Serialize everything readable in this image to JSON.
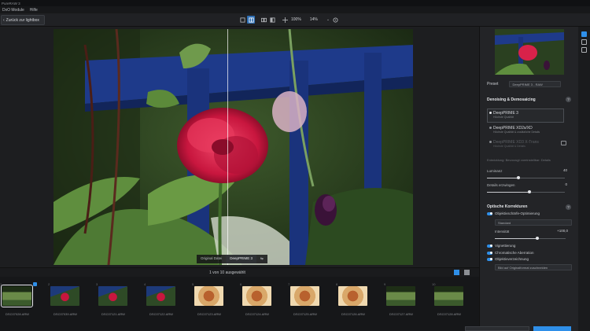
{
  "window": {
    "title": "PureRAW 3"
  },
  "menu": [
    "DxO Module",
    "Hilfe"
  ],
  "toolbar": {
    "back_label": "Zurück zur lightbox",
    "zoom_fit": "100%",
    "zoom_value": "14%"
  },
  "compare": {
    "before": "Original Datei",
    "after": "DeepPRIME 3"
  },
  "status": {
    "selection": "1 von 10 ausgewählt"
  },
  "filmstrip": [
    {
      "num": "1",
      "name": "DSC07028.ARW",
      "type": "garden",
      "selected": true
    },
    {
      "num": "2",
      "name": "DSC07039.ARW",
      "type": "flower",
      "selected": false
    },
    {
      "num": "3",
      "name": "DSC07121.ARW",
      "type": "flower",
      "selected": false
    },
    {
      "num": "4",
      "name": "DSC07122.ARW",
      "type": "flower",
      "selected": false
    },
    {
      "num": "5",
      "name": "DSC07123.ARW",
      "type": "food",
      "selected": false
    },
    {
      "num": "6",
      "name": "DSC07124.ARW",
      "type": "food",
      "selected": false
    },
    {
      "num": "7",
      "name": "DSC07125.ARW",
      "type": "food",
      "selected": false
    },
    {
      "num": "8",
      "name": "DSC07126.ARW",
      "type": "food",
      "selected": false
    },
    {
      "num": "9",
      "name": "DSC07127.ARW",
      "type": "garden",
      "selected": false
    },
    {
      "num": "10",
      "name": "DSC07128.ARW",
      "type": "garden",
      "selected": false
    }
  ],
  "panel": {
    "preset_label": "Preset",
    "preset_value": "DeepPRIME 3 - RAW",
    "denoise_title": "Denoising & Demosaicing",
    "options": [
      {
        "title": "DeepPRIME 3",
        "desc": "Höchste Qualität"
      },
      {
        "title": "DeepPRIME XD2s/XD",
        "desc": "Höchste Qualität & zusätzliche Details"
      },
      {
        "title": "DeepPRIME XD3 X-Trans",
        "desc": "Höchste Qualität & Details"
      }
    ],
    "note": "Entwicklung: Bevorzugt voreinstellbar: Details",
    "luminance_label": "Luminanz",
    "luminance_value": "40",
    "details_label": "Details erzwingen",
    "details_value": "0",
    "optical_title": "Optische Korrekturen",
    "lens_label": "Objektivschärfe-Optimierung",
    "lens_mode": "Standard",
    "intensity_label": "Intensität",
    "intensity_value": "+100,0",
    "toggles": [
      "Vignettierung",
      "Chromatische Aberration",
      "Objektivverzeichnung"
    ],
    "distortion_mode": "Bild auf Originalformat zuschneiden"
  },
  "levels": {
    "luminance": 0.4,
    "details": 0.55,
    "intensity": 0.6
  },
  "colors": {
    "accent": "#2f8fe8",
    "toggle": "#2f8fe8",
    "background": "#1b1c1e"
  }
}
